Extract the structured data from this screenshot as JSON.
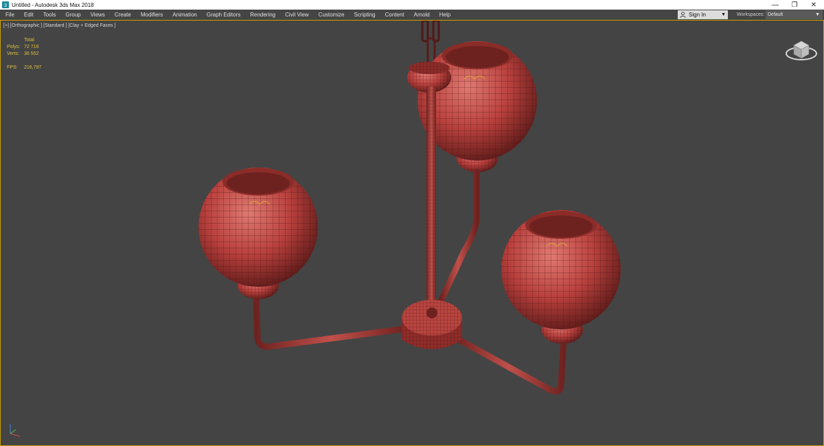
{
  "window": {
    "title": "Untitled - Autodesk 3ds Max 2018",
    "minimize_glyph": "—",
    "restore_glyph": "❐",
    "close_glyph": "✕"
  },
  "menu": [
    "File",
    "Edit",
    "Tools",
    "Group",
    "Views",
    "Create",
    "Modifiers",
    "Animation",
    "Graph Editors",
    "Rendering",
    "Civil View",
    "Customize",
    "Scripting",
    "Content",
    "Arnold",
    "Help"
  ],
  "account": {
    "sign_in_label": "Sign In",
    "caret": "▼"
  },
  "workspaces": {
    "label": "Workspaces:",
    "value": "Default",
    "caret": "▼"
  },
  "viewport": {
    "label": "[+] [Orthographic ] [Standard ] [Clay + Edged Faces ]",
    "stats": {
      "header": "Total",
      "polys_label": "Polys:",
      "polys_value": "72 716",
      "verts_label": "Verts:",
      "verts_value": "36 552",
      "fps_label": "FPS:",
      "fps_value": "216,797"
    }
  },
  "icons": {
    "app": "3ds-max-app-icon",
    "account": "person-icon",
    "viewcube": "viewcube-icon",
    "axis": "axis-tripod-icon"
  },
  "colors": {
    "viewport_bg": "#444444",
    "model_clay": "#b8403d",
    "stats_text": "#e0c23c",
    "active_border": "#c9a000"
  }
}
